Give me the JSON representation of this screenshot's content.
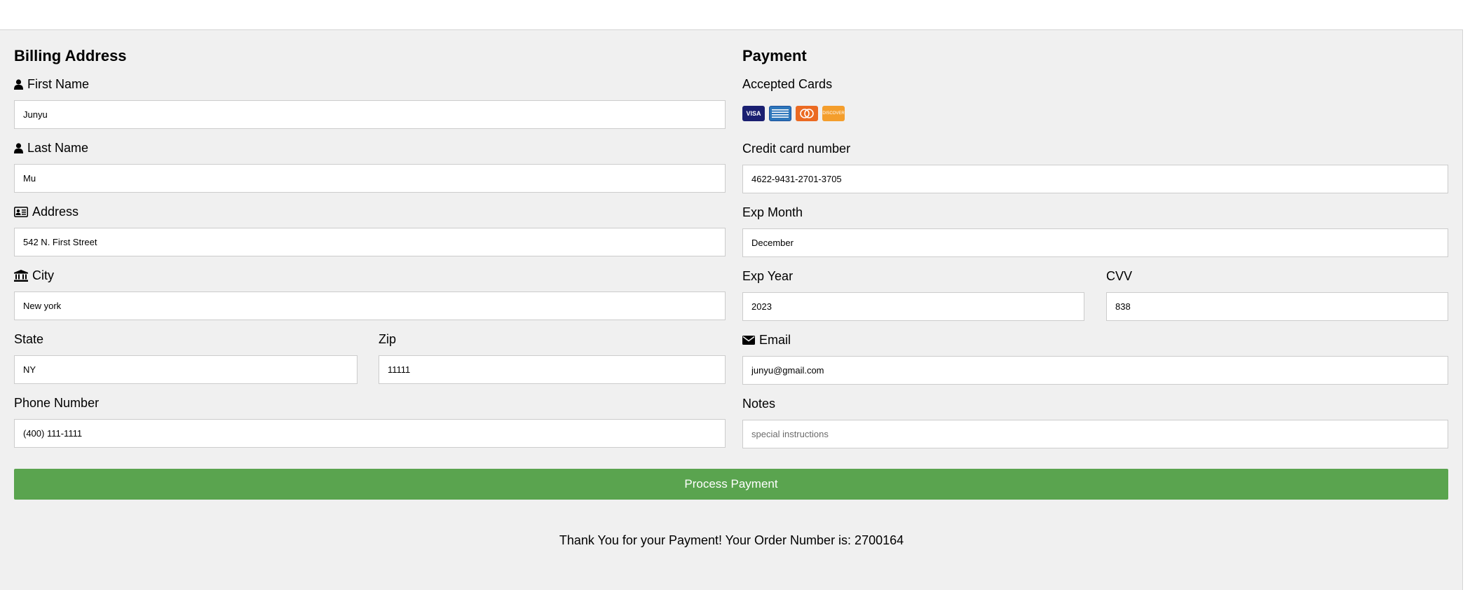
{
  "colors": {
    "button_bg": "#5aa44f",
    "panel_bg": "#f0f0f0",
    "visa": "#1a1f71",
    "amex": "#2e77bb",
    "mastercard": "#eb6a22",
    "discover": "#f49e2c"
  },
  "billing": {
    "title": "Billing Address",
    "first_name": {
      "label": "First Name",
      "value": "Junyu",
      "icon": "user-icon"
    },
    "last_name": {
      "label": "Last Name",
      "value": "Mu",
      "icon": "user-icon"
    },
    "address": {
      "label": "Address",
      "value": "542 N. First Street",
      "icon": "address-card-icon"
    },
    "city": {
      "label": "City",
      "value": "New york",
      "icon": "institution-icon"
    },
    "state": {
      "label": "State",
      "value": "NY"
    },
    "zip": {
      "label": "Zip",
      "value": "11111"
    },
    "phone": {
      "label": "Phone Number",
      "value": "(400) 111-1111"
    }
  },
  "payment": {
    "title": "Payment",
    "accepted_cards_label": "Accepted Cards",
    "cards": [
      {
        "name": "visa-icon",
        "text": "VISA"
      },
      {
        "name": "amex-icon",
        "text": ""
      },
      {
        "name": "mastercard-icon",
        "text": ""
      },
      {
        "name": "discover-icon",
        "text": "DISCOVER"
      }
    ],
    "card_number": {
      "label": "Credit card number",
      "value": "4622-9431-2701-3705"
    },
    "exp_month": {
      "label": "Exp Month",
      "value": "December"
    },
    "exp_year": {
      "label": "Exp Year",
      "value": "2023"
    },
    "cvv": {
      "label": "CVV",
      "value": "838"
    },
    "email": {
      "label": "Email",
      "value": "junyu@gmail.com",
      "icon": "envelope-icon"
    },
    "notes": {
      "label": "Notes",
      "value": "",
      "placeholder": "special instructions"
    }
  },
  "submit_label": "Process Payment",
  "thanks_message": "Thank You for your Payment! Your Order Number is: 2700164"
}
